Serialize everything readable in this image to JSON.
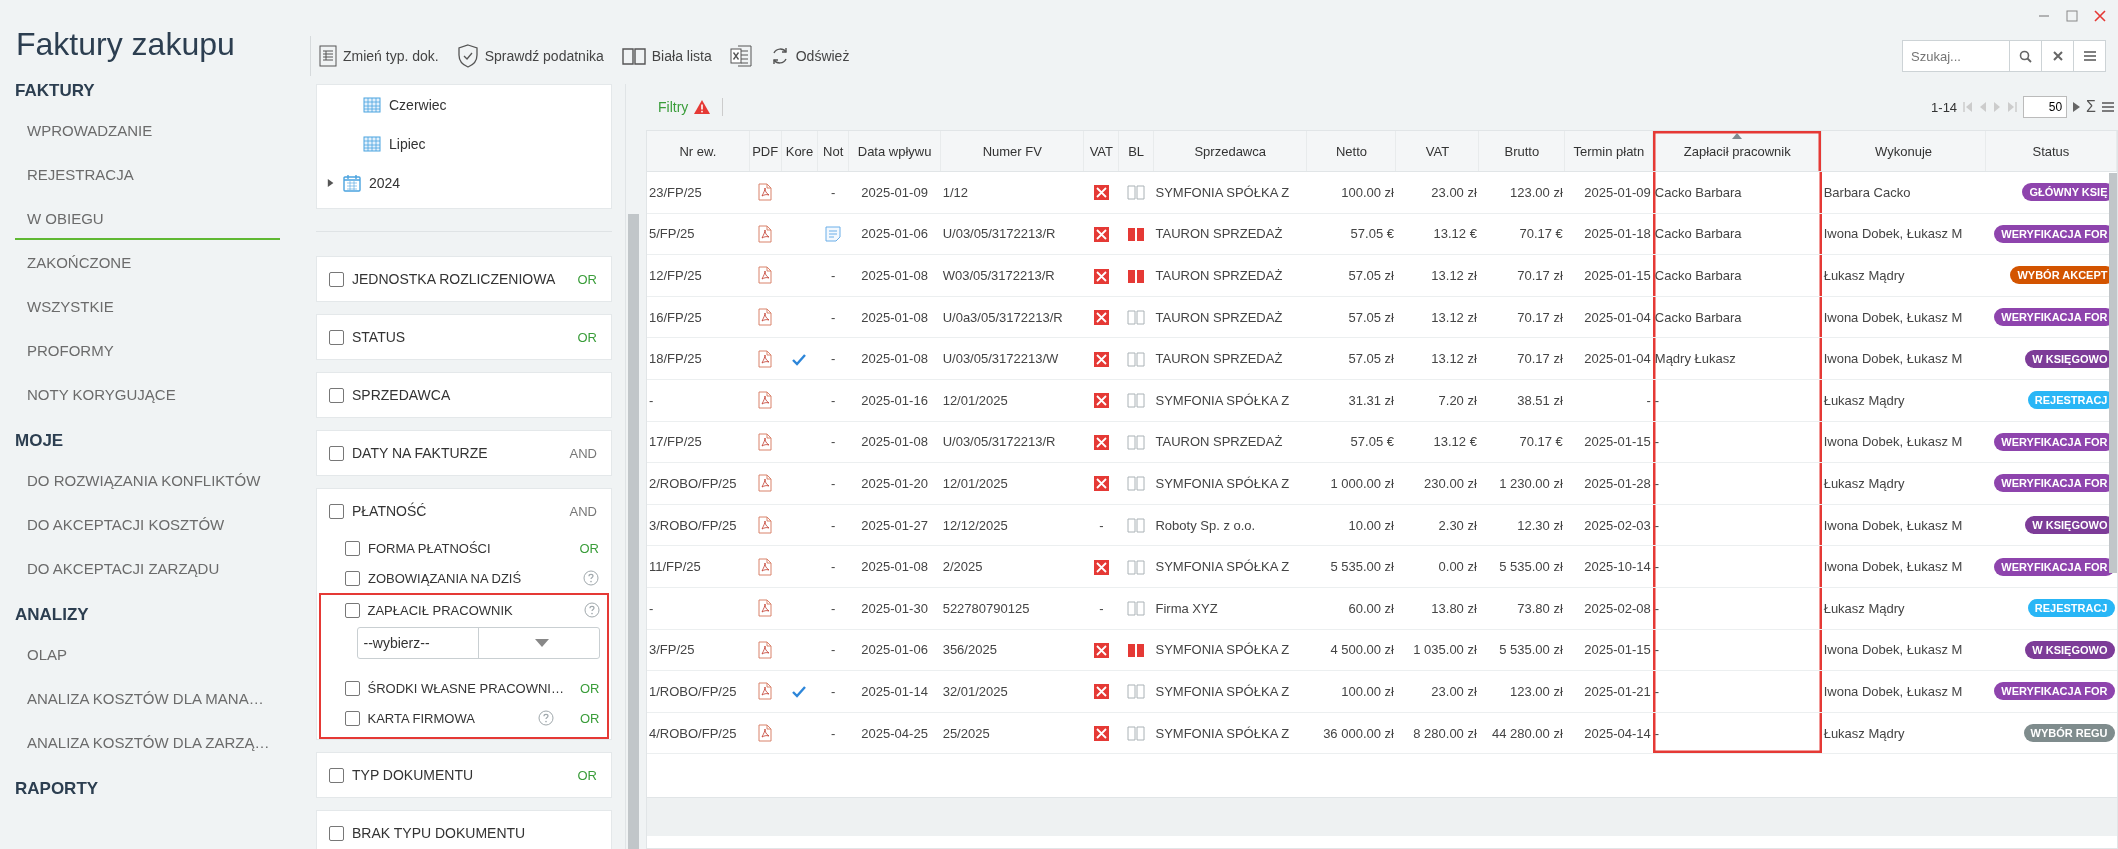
{
  "app": {
    "title": "Faktury zakupu"
  },
  "sidebar": {
    "sections": [
      {
        "title": "FAKTURY",
        "items": [
          {
            "label": "WPROWADZANIE",
            "selected": false
          },
          {
            "label": "REJESTRACJA",
            "selected": false
          },
          {
            "label": "W OBIEGU",
            "selected": true
          },
          {
            "label": "ZAKOŃCZONE",
            "selected": false
          },
          {
            "label": "WSZYSTKIE",
            "selected": false
          },
          {
            "label": "PROFORMY",
            "selected": false
          },
          {
            "label": "NOTY KORYGUJĄCE",
            "selected": false
          }
        ]
      },
      {
        "title": "MOJE",
        "items": [
          {
            "label": "DO ROZWIĄZANIA KONFLIKTÓW",
            "selected": false
          },
          {
            "label": "DO AKCEPTACJI KOSZTÓW",
            "selected": false
          },
          {
            "label": "DO AKCEPTACJI ZARZĄDU",
            "selected": false
          }
        ]
      },
      {
        "title": "ANALIZY",
        "items": [
          {
            "label": "OLAP",
            "selected": false
          },
          {
            "label": "ANALIZA KOSZTÓW DLA MANA…",
            "selected": false
          },
          {
            "label": "ANALIZA KOSZTÓW DLA ZARZĄ…",
            "selected": false
          }
        ]
      },
      {
        "title": "RAPORTY"
      }
    ]
  },
  "toolbar": {
    "buttons": [
      {
        "kind": "document",
        "label": "Zmień typ. dok."
      },
      {
        "kind": "shield",
        "label": "Sprawdź podatnika"
      },
      {
        "kind": "book",
        "label": "Biała lista"
      },
      {
        "kind": "excel"
      },
      {
        "kind": "refresh",
        "label": "Odśwież"
      }
    ]
  },
  "search": {
    "placeholder": "Szukaj..."
  },
  "filter_tree": [
    {
      "kind": "month",
      "label": "Czerwiec"
    },
    {
      "kind": "month",
      "label": "Lipiec"
    },
    {
      "kind": "year",
      "label": "2024",
      "expanded": false
    }
  ],
  "filter_groups": [
    {
      "label": "JEDNOSTKA ROZLICZENIOWA",
      "checked": false,
      "mode": {
        "label": "OR",
        "kind": "or"
      }
    },
    {
      "label": "STATUS",
      "checked": false,
      "mode": {
        "label": "OR",
        "kind": "or"
      }
    },
    {
      "label": "SPRZEDAWCA",
      "checked": false
    },
    {
      "label": "DATY NA FAKTURZE",
      "checked": false,
      "mode": {
        "label": "AND",
        "kind": "and"
      }
    },
    {
      "label": "PŁATNOŚĆ",
      "checked": false,
      "mode": {
        "label": "AND",
        "kind": "and"
      },
      "children": [
        {
          "label": "FORMA PŁATNOŚCI",
          "checked": false,
          "help": false,
          "highlighted": false,
          "mode": {
            "label": "OR",
            "kind": "or"
          }
        },
        {
          "label": "ZOBOWIĄZANIA NA DZIŚ",
          "checked": false,
          "help": true,
          "highlighted": false
        },
        {
          "label": "ZAPŁACIŁ PRACOWNIK",
          "checked": false,
          "help": true,
          "highlighted": true,
          "select": {
            "value": "--wybierz--"
          }
        },
        {
          "label": "ŚRODKI WŁASNE PRACOWNI…",
          "checked": false,
          "help": false,
          "highlighted": true,
          "mode": {
            "label": "OR",
            "kind": "or"
          }
        },
        {
          "label": "KARTA FIRMOWA",
          "checked": false,
          "help": true,
          "highlighted": true,
          "mode": {
            "label": "OR",
            "kind": "or"
          }
        }
      ]
    },
    {
      "label": "TYP DOKUMENTU",
      "checked": false,
      "mode": {
        "label": "OR",
        "kind": "or"
      }
    },
    {
      "label": "BRAK TYPU DOKUMENTU",
      "checked": false
    }
  ],
  "filter_bar": {
    "label": "Filtry",
    "warning": true
  },
  "pager": {
    "range": "1-14",
    "page_size": "50",
    "sum": "Σ"
  },
  "table": {
    "columns": [
      {
        "label": "Nr ew.",
        "highlighted": false,
        "sorted": false
      },
      {
        "label": "PDF",
        "highlighted": false,
        "sorted": false
      },
      {
        "label": "Kore",
        "highlighted": false,
        "sorted": false
      },
      {
        "label": "Not",
        "highlighted": false,
        "sorted": false
      },
      {
        "label": "Data wpływu",
        "highlighted": false,
        "sorted": false
      },
      {
        "label": "Numer FV",
        "highlighted": false,
        "sorted": false
      },
      {
        "label": "VAT",
        "highlighted": false,
        "sorted": false
      },
      {
        "label": "BL",
        "highlighted": false,
        "sorted": false
      },
      {
        "label": "Sprzedawca",
        "highlighted": false,
        "sorted": false
      },
      {
        "label": "Netto",
        "highlighted": false,
        "sorted": false
      },
      {
        "label": "VAT",
        "highlighted": false,
        "sorted": false
      },
      {
        "label": "Brutto",
        "highlighted": false,
        "sorted": false
      },
      {
        "label": "Termin płatn",
        "highlighted": false,
        "sorted": false
      },
      {
        "label": "Zapłacił pracownik",
        "highlighted": true,
        "sorted": true
      },
      {
        "label": "Wykonuje",
        "highlighted": false,
        "sorted": false
      },
      {
        "label": "Status",
        "highlighted": false,
        "sorted": false
      }
    ],
    "rows": [
      {
        "nr": "23/FP/25",
        "korekta": false,
        "nota": "-",
        "nota_attached": false,
        "data": "2025-01-09",
        "numer": "1/12",
        "vat_flag": true,
        "bl_flag": false,
        "sprzedawca": "SYMFONIA SPÓŁKA Z",
        "netto": "100.00 zł",
        "vat": "23.00 zł",
        "brutto": "123.00 zł",
        "termin": "2025-01-09",
        "zaplacil": "Cacko Barbara",
        "wykonuje": "Barbara Cacko",
        "status": {
          "label": "GŁÓWNY KSIĘ",
          "color": "#8e44ad"
        }
      },
      {
        "nr": "5/FP/25",
        "korekta": false,
        "nota_attached": true,
        "data": "2025-01-06",
        "numer": "U/03/05/3172213/R",
        "vat_flag": true,
        "bl_flag": true,
        "sprzedawca": "TAURON SPRZEDAŻ",
        "netto": "57.05 €",
        "vat": "13.12 €",
        "brutto": "70.17 €",
        "termin": "2025-01-18",
        "zaplacil": "Cacko Barbara",
        "wykonuje": "Iwona Dobek, Łukasz M",
        "status": {
          "label": "WERYFIKACJA FOR",
          "color": "#8e44ad"
        }
      },
      {
        "nr": "12/FP/25",
        "korekta": false,
        "nota": "-",
        "nota_attached": false,
        "data": "2025-01-08",
        "numer": "W03/05/3172213/R",
        "vat_flag": true,
        "bl_flag": true,
        "sprzedawca": "TAURON SPRZEDAŻ",
        "netto": "57.05 zł",
        "vat": "13.12 zł",
        "brutto": "70.17 zł",
        "termin": "2025-01-15",
        "zaplacil": "Cacko Barbara",
        "wykonuje": "Łukasz Mądry",
        "status": {
          "label": "WYBÓR AKCEPT",
          "color": "#d35400"
        }
      },
      {
        "nr": "16/FP/25",
        "korekta": false,
        "nota": "-",
        "nota_attached": false,
        "data": "2025-01-08",
        "numer": "U/0a3/05/3172213/R",
        "vat_flag": true,
        "bl_flag": false,
        "sprzedawca": "TAURON SPRZEDAŻ",
        "netto": "57.05 zł",
        "vat": "13.12 zł",
        "brutto": "70.17 zł",
        "termin": "2025-01-04",
        "zaplacil": "Cacko Barbara",
        "wykonuje": "Iwona Dobek, Łukasz M",
        "status": {
          "label": "WERYFIKACJA FOR",
          "color": "#8e44ad"
        }
      },
      {
        "nr": "18/FP/25",
        "korekta": true,
        "nota": "-",
        "nota_attached": false,
        "data": "2025-01-08",
        "numer": "U/03/05/3172213/W",
        "vat_flag": true,
        "bl_flag": false,
        "sprzedawca": "TAURON SPRZEDAŻ",
        "netto": "57.05 zł",
        "vat": "13.12 zł",
        "brutto": "70.17 zł",
        "termin": "2025-01-04",
        "zaplacil": "Mądry Łukasz",
        "wykonuje": "Iwona Dobek, Łukasz M",
        "status": {
          "label": "W KSIĘGOWO",
          "color": "#7d3c98"
        }
      },
      {
        "nr": "-",
        "korekta": false,
        "nota": "-",
        "nota_attached": false,
        "data": "2025-01-16",
        "numer": "12/01/2025",
        "vat_flag": true,
        "bl_flag": false,
        "sprzedawca": "SYMFONIA SPÓŁKA Z",
        "netto": "31.31 zł",
        "vat": "7.20 zł",
        "brutto": "38.51 zł",
        "termin": "-",
        "zaplacil": "-",
        "wykonuje": "Łukasz Mądry",
        "status": {
          "label": "REJESTRACJ",
          "color": "#29b6f6"
        }
      },
      {
        "nr": "17/FP/25",
        "korekta": false,
        "nota": "-",
        "nota_attached": false,
        "data": "2025-01-08",
        "numer": "U/03/05/3172213/R",
        "vat_flag": true,
        "bl_flag": false,
        "sprzedawca": "TAURON SPRZEDAŻ",
        "netto": "57.05 €",
        "vat": "13.12 €",
        "brutto": "70.17 €",
        "termin": "2025-01-15",
        "zaplacil": "-",
        "wykonuje": "Iwona Dobek, Łukasz M",
        "status": {
          "label": "WERYFIKACJA FOR",
          "color": "#8e44ad"
        }
      },
      {
        "nr": "2/ROBO/FP/25",
        "korekta": false,
        "nota": "-",
        "nota_attached": false,
        "data": "2025-01-20",
        "numer": "12/01/2025",
        "vat_flag": true,
        "bl_flag": false,
        "sprzedawca": "SYMFONIA SPÓŁKA Z",
        "netto": "1 000.00 zł",
        "vat": "230.00 zł",
        "brutto": "1 230.00 zł",
        "termin": "2025-01-28",
        "zaplacil": "-",
        "wykonuje": "Łukasz Mądry",
        "status": {
          "label": "WERYFIKACJA FOR",
          "color": "#8e44ad"
        }
      },
      {
        "nr": "3/ROBO/FP/25",
        "korekta": false,
        "nota": "-",
        "nota_attached": false,
        "data": "2025-01-27",
        "numer": "12/12/2025",
        "vat_flag": false,
        "vat_flag_text": "-",
        "bl_flag": false,
        "sprzedawca": "Roboty Sp. z o.o.",
        "netto": "10.00 zł",
        "vat": "2.30 zł",
        "brutto": "12.30 zł",
        "termin": "2025-02-03",
        "zaplacil": "-",
        "wykonuje": "Iwona Dobek, Łukasz M",
        "status": {
          "label": "W KSIĘGOWO",
          "color": "#7d3c98"
        }
      },
      {
        "nr": "11/FP/25",
        "korekta": false,
        "nota": "-",
        "nota_attached": false,
        "data": "2025-01-08",
        "numer": "2/2025",
        "vat_flag": true,
        "bl_flag": false,
        "sprzedawca": "SYMFONIA SPÓŁKA Z",
        "netto": "5 535.00 zł",
        "vat": "0.00 zł",
        "brutto": "5 535.00 zł",
        "termin": "2025-10-14",
        "zaplacil": "-",
        "wykonuje": "Iwona Dobek, Łukasz M",
        "status": {
          "label": "WERYFIKACJA FOR",
          "color": "#8e44ad"
        }
      },
      {
        "nr": "-",
        "korekta": false,
        "nota": "-",
        "nota_attached": false,
        "data": "2025-01-30",
        "numer": "522780790125",
        "vat_flag": false,
        "vat_flag_text": "-",
        "bl_flag": false,
        "sprzedawca": "Firma XYZ",
        "netto": "60.00 zł",
        "vat": "13.80 zł",
        "brutto": "73.80 zł",
        "termin": "2025-02-08",
        "zaplacil": "-",
        "wykonuje": "Łukasz Mądry",
        "status": {
          "label": "REJESTRACJ",
          "color": "#29b6f6"
        }
      },
      {
        "nr": "3/FP/25",
        "korekta": false,
        "nota": "-",
        "nota_attached": false,
        "data": "2025-01-06",
        "numer": "356/2025",
        "vat_flag": true,
        "bl_flag": true,
        "sprzedawca": "SYMFONIA SPÓŁKA Z",
        "netto": "4 500.00 zł",
        "vat": "1 035.00 zł",
        "brutto": "5 535.00 zł",
        "termin": "2025-01-15",
        "zaplacil": "-",
        "wykonuje": "Iwona Dobek, Łukasz M",
        "status": {
          "label": "W KSIĘGOWO",
          "color": "#7d3c98"
        }
      },
      {
        "nr": "1/ROBO/FP/25",
        "korekta": true,
        "nota": "-",
        "nota_attached": false,
        "data": "2025-01-14",
        "numer": "32/01/2025",
        "vat_flag": true,
        "bl_flag": false,
        "sprzedawca": "SYMFONIA SPÓŁKA Z",
        "netto": "100.00 zł",
        "vat": "23.00 zł",
        "brutto": "123.00 zł",
        "termin": "2025-01-21",
        "zaplacil": "-",
        "wykonuje": "Iwona Dobek, Łukasz M",
        "status": {
          "label": "WERYFIKACJA FOR",
          "color": "#8e44ad"
        }
      },
      {
        "nr": "4/ROBO/FP/25",
        "korekta": false,
        "nota": "-",
        "nota_attached": false,
        "data": "2025-04-25",
        "numer": "25/2025",
        "vat_flag": true,
        "bl_flag": false,
        "sprzedawca": "SYMFONIA SPÓŁKA Z",
        "netto": "36 000.00 zł",
        "vat": "8 280.00 zł",
        "brutto": "44 280.00 zł",
        "termin": "2025-04-14",
        "zaplacil": "-",
        "wykonuje": "Łukasz Mądry",
        "status": {
          "label": "WYBÓR REGU",
          "color": "#7f8c8d"
        }
      }
    ]
  }
}
